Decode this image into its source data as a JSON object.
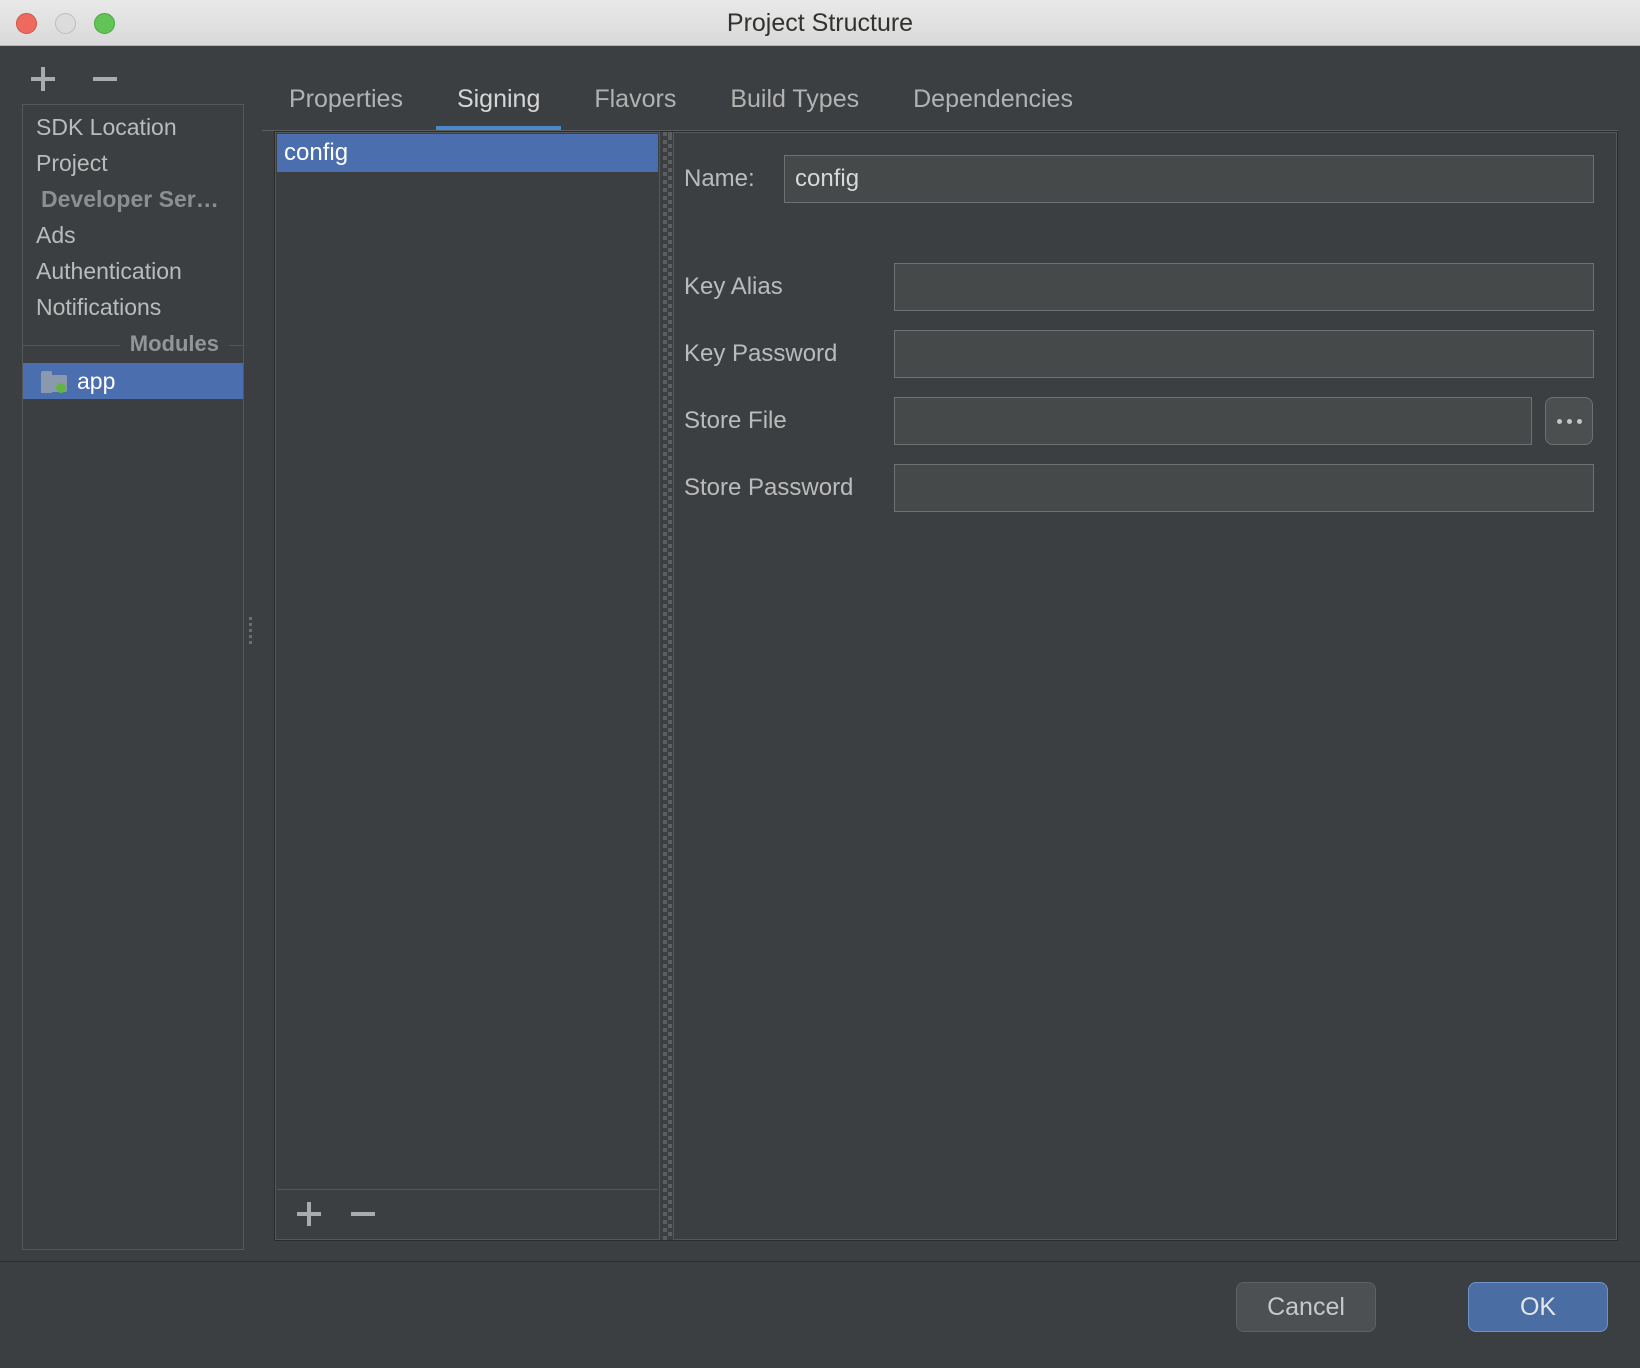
{
  "window": {
    "title": "Project Structure",
    "traffic_lights": [
      "close-light",
      "minimize-light",
      "maximize-light"
    ]
  },
  "sidebar": {
    "toolbar": {
      "add_label": "+",
      "remove_label": "−"
    },
    "items": [
      {
        "label": "SDK Location",
        "muted": false,
        "selected": false
      },
      {
        "label": "Project",
        "muted": false,
        "selected": false
      },
      {
        "label": "Developer Ser…",
        "muted": true,
        "selected": false
      },
      {
        "label": "Ads",
        "muted": false,
        "selected": false
      },
      {
        "label": "Authentication",
        "muted": false,
        "selected": false
      },
      {
        "label": "Notifications",
        "muted": false,
        "selected": false
      }
    ],
    "group_header": "Modules",
    "modules": [
      {
        "label": "app",
        "icon": "folder-icon",
        "selected": true
      }
    ]
  },
  "tabs": [
    {
      "label": "Properties",
      "active": false
    },
    {
      "label": "Signing",
      "active": true
    },
    {
      "label": "Flavors",
      "active": false
    },
    {
      "label": "Build Types",
      "active": false
    },
    {
      "label": "Dependencies",
      "active": false
    }
  ],
  "signing": {
    "list": {
      "rows": [
        {
          "label": "config",
          "selected": true
        }
      ],
      "toolbar": {
        "add_label": "+",
        "remove_label": "−"
      }
    },
    "form": {
      "name": {
        "label": "Name:",
        "value": "config",
        "placeholder": ""
      },
      "fields": [
        {
          "label": "Key Alias",
          "value": "",
          "placeholder": ""
        },
        {
          "label": "Key Password",
          "value": "",
          "placeholder": ""
        },
        {
          "label": "Store File",
          "value": "",
          "placeholder": "",
          "browse_label": "..."
        },
        {
          "label": "Store Password",
          "value": "",
          "placeholder": ""
        }
      ]
    }
  },
  "footer": {
    "cancel_label": "Cancel",
    "ok_label": "OK"
  },
  "colors": {
    "accent": "#4b6eaf",
    "tab_underline": "#4a88c7",
    "ok_button": "#4a6da4",
    "background": "#3c3f41",
    "module_badge": "#62b543"
  }
}
